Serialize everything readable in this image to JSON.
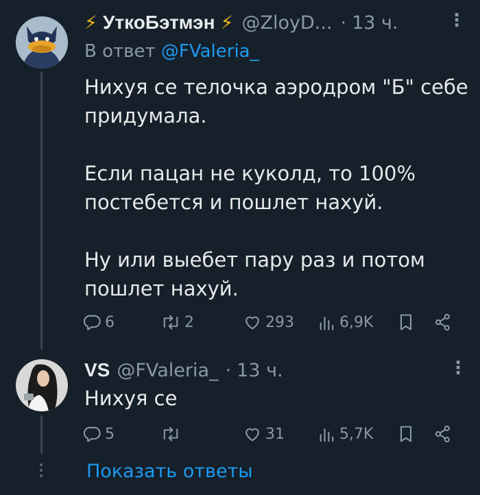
{
  "tweet1": {
    "display_name": "УткоБэтмэн",
    "handle": "@ZloyD...",
    "separator": "·",
    "time": "13 ч.",
    "reply_prefix": "В ответ",
    "reply_to": "@FValeria_",
    "text": "Нихуя се телочка аэродром \"Б\" себе придумала.\n\nЕсли пацан не куколд, то 100% постебется и пошлет нахуй.\n\nНу или выебет пару раз и потом пошлет нахуй.",
    "replies": "6",
    "retweets": "2",
    "likes": "293",
    "views": "6,9K"
  },
  "tweet2": {
    "display_name": "VS",
    "handle": "@FValeria_",
    "separator": "·",
    "time": "13 ч.",
    "text": "Нихуя се",
    "replies": "5",
    "retweets": "",
    "likes": "31",
    "views": "5,7K"
  },
  "show_replies_label": "Показать ответы",
  "colors": {
    "background": "#15202b",
    "accent": "#1d9bf0",
    "muted": "#8b98a5",
    "bolt": "#f5b71b"
  }
}
